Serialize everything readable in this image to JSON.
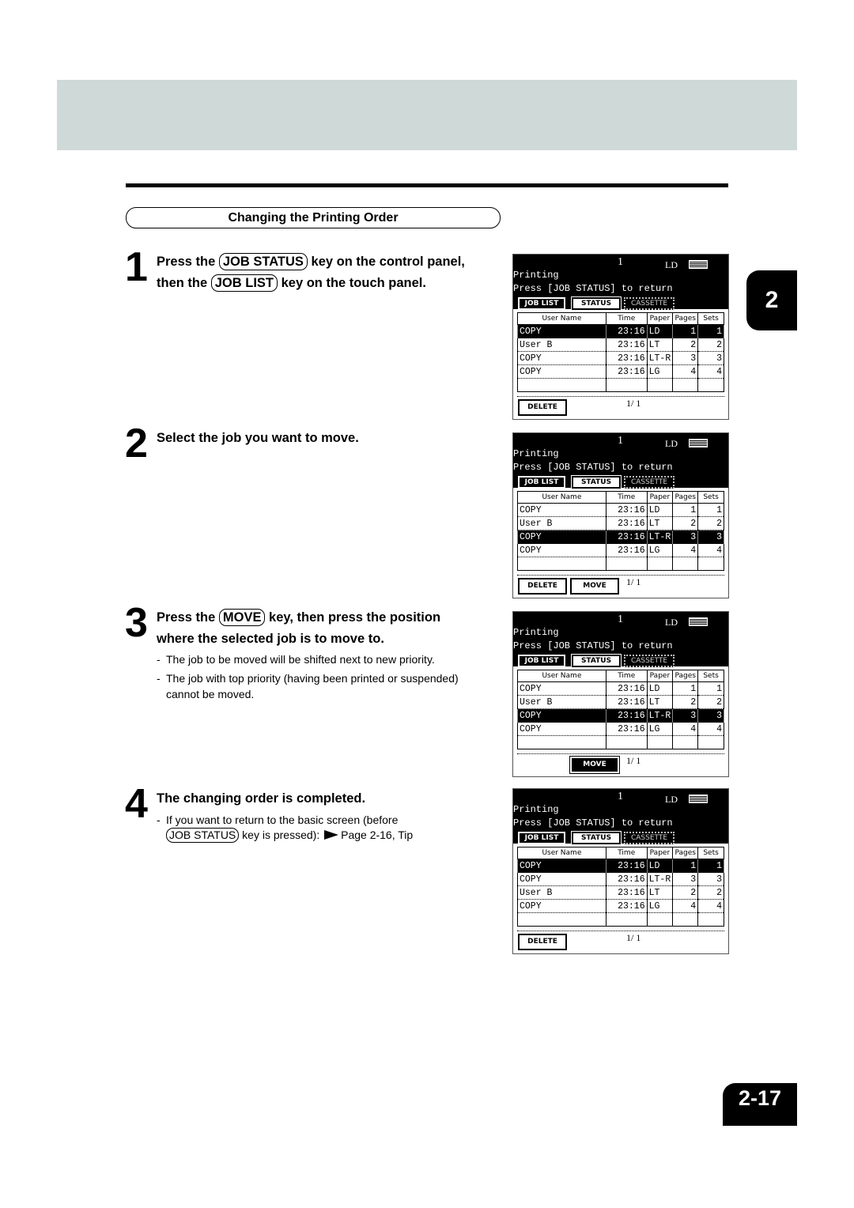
{
  "section_title": "Changing the Printing Order",
  "chapter_tab": "2",
  "page_number": "2-17",
  "steps": [
    {
      "number": "1",
      "line1_pre": "Press the ",
      "line1_key": "JOB STATUS",
      "line1_post": " key on the control panel,",
      "line2_pre": "then the ",
      "line2_key": "JOB LIST",
      "line2_post": " key on the touch panel."
    },
    {
      "number": "2",
      "line1": "Select the job you want to move."
    },
    {
      "number": "3",
      "line1_pre": "Press the ",
      "line1_key": "MOVE",
      "line1_post": " key, then press the position",
      "line2": "where the selected job is to move to.",
      "notes": [
        "The job to be moved will be shifted next to new priority.",
        "The job with top priority (having been printed or suspended)",
        "cannot be moved."
      ]
    },
    {
      "number": "4",
      "line1": "The changing order is completed.",
      "note_line1": "If you want to return to the basic screen (before",
      "note_key": "JOB STATUS",
      "note_line2": " key is pressed): ",
      "note_ref": "Page 2-16, Tip"
    }
  ],
  "panel_common": {
    "copies": "1",
    "paper": "LD",
    "status": "Printing",
    "instruction": "Press [JOB STATUS] to return",
    "tabs": [
      "JOB LIST",
      "STATUS",
      "CASSETTE"
    ],
    "columns": [
      "User Name",
      "Time",
      "Paper",
      "Pages",
      "Sets"
    ],
    "delete_label": "DELETE",
    "move_label": "MOVE",
    "page_indicator": "1/ 1"
  },
  "panels": [
    {
      "selected_row": 0,
      "rows": [
        [
          "COPY",
          "23:16",
          "LD",
          "1",
          "1"
        ],
        [
          "User B",
          "23:16",
          "LT",
          "2",
          "2"
        ],
        [
          "COPY",
          "23:16",
          "LT-R",
          "3",
          "3"
        ],
        [
          "COPY",
          "23:16",
          "LG",
          "4",
          "4"
        ],
        [
          "",
          "",
          "",
          "",
          ""
        ]
      ]
    },
    {
      "selected_row": 2,
      "rows": [
        [
          "COPY",
          "23:16",
          "LD",
          "1",
          "1"
        ],
        [
          "User B",
          "23:16",
          "LT",
          "2",
          "2"
        ],
        [
          "COPY",
          "23:16",
          "LT-R",
          "3",
          "3"
        ],
        [
          "COPY",
          "23:16",
          "LG",
          "4",
          "4"
        ],
        [
          "",
          "",
          "",
          "",
          ""
        ]
      ]
    },
    {
      "selected_row": 2,
      "rows": [
        [
          "COPY",
          "23:16",
          "LD",
          "1",
          "1"
        ],
        [
          "User B",
          "23:16",
          "LT",
          "2",
          "2"
        ],
        [
          "COPY",
          "23:16",
          "LT-R",
          "3",
          "3"
        ],
        [
          "COPY",
          "23:16",
          "LG",
          "4",
          "4"
        ],
        [
          "",
          "",
          "",
          "",
          ""
        ]
      ]
    },
    {
      "selected_row": 0,
      "rows": [
        [
          "COPY",
          "23:16",
          "LD",
          "1",
          "1"
        ],
        [
          "COPY",
          "23:16",
          "LT-R",
          "3",
          "3"
        ],
        [
          "User B",
          "23:16",
          "LT",
          "2",
          "2"
        ],
        [
          "COPY",
          "23:16",
          "LG",
          "4",
          "4"
        ],
        [
          "",
          "",
          "",
          "",
          ""
        ]
      ]
    }
  ]
}
